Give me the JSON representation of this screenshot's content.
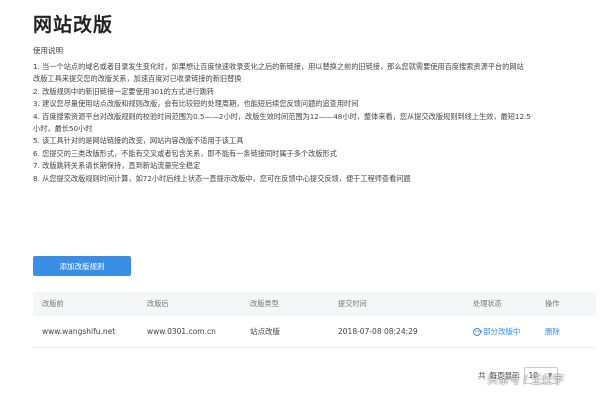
{
  "page": {
    "title": "网站改版",
    "section_title": "使用说明"
  },
  "notes": [
    "1. 当一个站点的域名或者目录发生变化时，如果想让百度快速收录变化之后的新链接，用以替换之前的旧链接，那么您就需要使用百度搜索资源平台的网站",
    "改版工具来提交您的改版关系，加速百度对已收录链接的新旧替换",
    "2. 改版规则中的新旧链接一定要使用301的方式进行跳转",
    "3. 建议您尽量使用站点改版和规则改版，会有比较短的处理周期，也能短后续您反馈问题的追查用时间",
    "4. 百度搜索资源平台对改版规则的校验时间范围为0.5——2小时，改版生效时间范围为12——48小时，整体来看，您从提交改版规则到线上生效，最短12.5",
    "小时，最长50小时",
    "5. 该工具针对的是网站链接的改变，网站内容改版不适用于该工具",
    "6. 您提交的三类改版形式，不能有交叉或者包含关系，即不能有一条链接同时属于多个改版形式",
    "7. 改版跳转关系请长期保持，直到新站流量完全稳定",
    "8. 从您提交改版规则时间计算，如72小时后线上状态一直提示改版中，您可在反馈中心提交反馈，便于工程师查看问题"
  ],
  "toolbar": {
    "add_button_label": "添加改版规则"
  },
  "table": {
    "headers": [
      "改版前",
      "改版后",
      "改版类型",
      "提交时间",
      "处理状态",
      "操作"
    ],
    "rows": [
      {
        "before": "www.wangshifu.net",
        "after": "www.0301.com.cn",
        "type": "站点改版",
        "time": "2018-07-08 08:24:29",
        "status": "部分改版中",
        "action": "删除"
      }
    ]
  },
  "pager": {
    "total_prefix": "共",
    "per_page_label": "每页显示",
    "per_page_value": "10"
  },
  "watermark": "头条号 / 王仕宇",
  "colors": {
    "accent": "#3a8ee6",
    "header_bg": "#f5f6f8"
  },
  "icons": {
    "status": "ellipsis-circle-icon",
    "select": "chevron-down-icon"
  }
}
